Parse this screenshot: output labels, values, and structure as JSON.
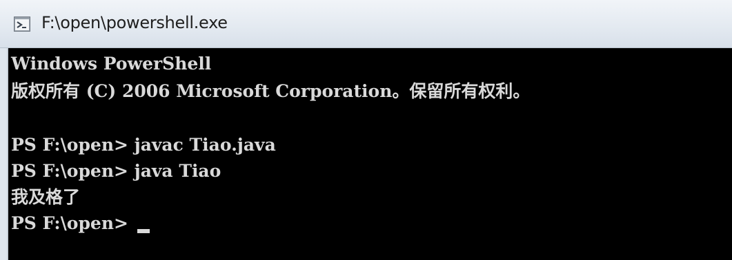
{
  "window": {
    "title": "F:\\open\\powershell.exe",
    "icon": "powershell-icon"
  },
  "console": {
    "lines": [
      "Windows PowerShell",
      "版权所有 (C) 2006 Microsoft Corporation。保留所有权利。",
      "",
      "PS F:\\open> javac Tiao.java",
      "PS F:\\open> java Tiao",
      "我及格了",
      "PS F:\\open> "
    ]
  },
  "colors": {
    "console_background": "#000000",
    "console_text": "#d9d9d9",
    "titlebar": "#e4eaf1"
  }
}
